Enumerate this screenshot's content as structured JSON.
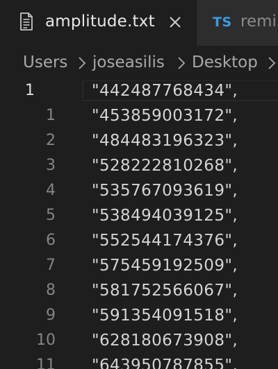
{
  "tabs": [
    {
      "label": "amplitude.txt",
      "icon": "text-file-icon",
      "active": true
    },
    {
      "badge": "TS",
      "label": "remi",
      "icon": "typescript-icon",
      "active": false
    }
  ],
  "breadcrumb": {
    "items": [
      "Users",
      "joseasilis",
      "Desktop"
    ]
  },
  "editor": {
    "lines": [
      {
        "number": "1",
        "text": "\"442487768434\",",
        "current": true
      },
      {
        "number": "1",
        "text": "\"453859003172\","
      },
      {
        "number": "2",
        "text": "\"484483196323\","
      },
      {
        "number": "3",
        "text": "\"528222810268\","
      },
      {
        "number": "4",
        "text": "\"535767093619\","
      },
      {
        "number": "5",
        "text": "\"538494039125\","
      },
      {
        "number": "6",
        "text": "\"552544174376\","
      },
      {
        "number": "7",
        "text": "\"575459192509\","
      },
      {
        "number": "8",
        "text": "\"581752566067\","
      },
      {
        "number": "9",
        "text": "\"591354091518\","
      },
      {
        "number": "10",
        "text": "\"628180673908\","
      },
      {
        "number": "11",
        "text": "\"643950787855\","
      }
    ]
  },
  "colors": {
    "background": "#1e1e1e",
    "tabbar": "#252526",
    "inactive_tab": "#2d2d2d",
    "ts_badge": "#3c9ce0",
    "text": "#d4d4d4",
    "line_number": "#858585"
  }
}
